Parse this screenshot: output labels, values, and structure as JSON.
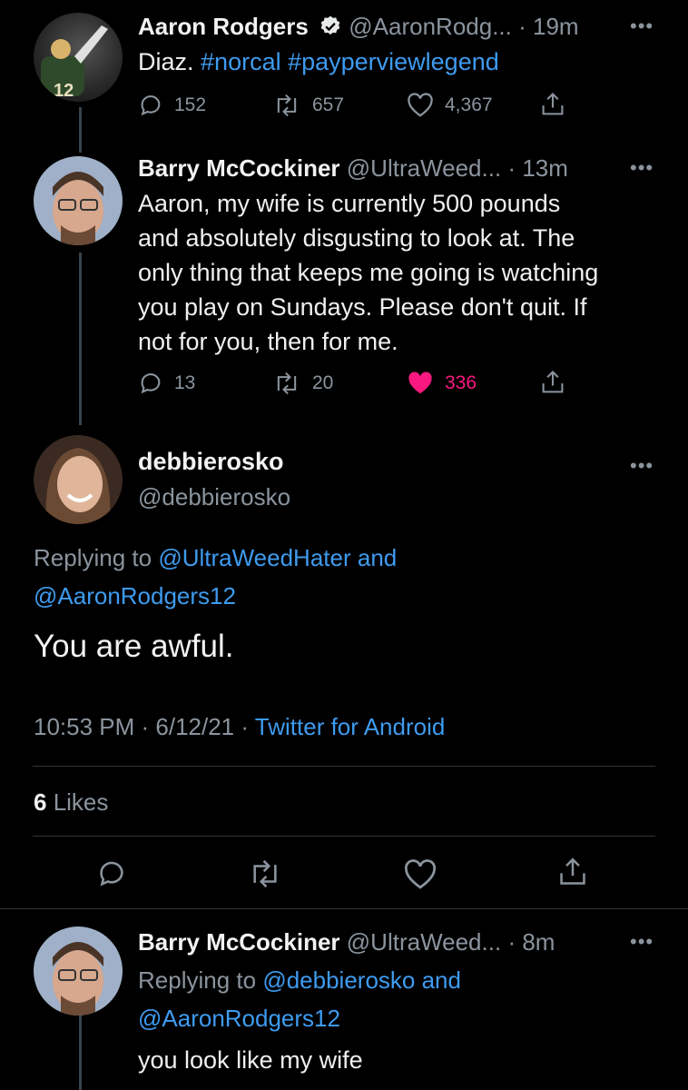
{
  "tweet1": {
    "name": "Aaron Rodgers",
    "handle": "@AaronRodg...",
    "time": "· 19m",
    "text_plain": "Diaz. ",
    "hashtags": "#norcal #payperviewlegend",
    "replies": "152",
    "retweets": "657",
    "likes": "4,367"
  },
  "tweet2": {
    "name": "Barry McCockiner",
    "handle": "@UltraWeed...",
    "time": "· 13m",
    "lines": [
      "Aaron, my wife is currently 500 pounds",
      "and absolutely disgusting to look at. The",
      "only thing that keeps me going is watching",
      "you play on Sundays. Please don't quit. If",
      "not for you, then for me."
    ],
    "replies": "13",
    "retweets": "20",
    "likes": "336",
    "like_color": "#f91880"
  },
  "main_tweet": {
    "name": "debbierosko",
    "handle": "@debbierosko",
    "replying_prefix": "Replying to ",
    "replying_user1": "@UltraWeedHater",
    "replying_and": " and",
    "replying_user2": "@AaronRodgers12",
    "text": "You are awful.",
    "timestamp": "10:53 PM · 6/12/21 · ",
    "source": "Twitter for Android",
    "likes_count": "6",
    "likes_label": " Likes"
  },
  "reply": {
    "name": "Barry McCockiner",
    "handle": "@UltraWeed...",
    "time": "· 8m",
    "replying_prefix": "Replying to ",
    "replying_user1": "@debbierosko",
    "replying_and": " and",
    "replying_user2": "@AaronRodgers12",
    "text": "you look like my wife"
  },
  "colors": {
    "accent": "#3e9bef",
    "background": "#000000",
    "muted": "#8b949e"
  },
  "icons": [
    "verified-badge-icon",
    "reply-icon",
    "retweet-icon",
    "like-icon",
    "share-icon",
    "more-icon"
  ]
}
